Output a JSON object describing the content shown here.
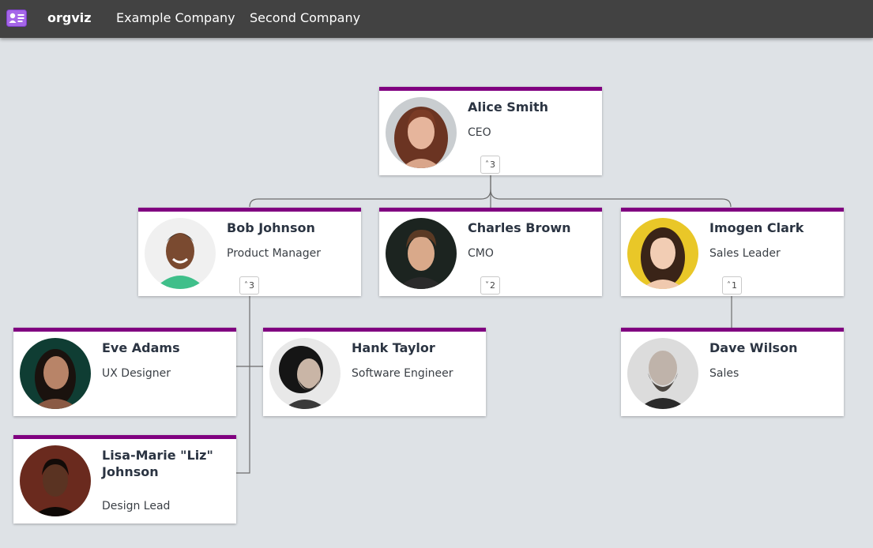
{
  "app": {
    "title": "orgviz"
  },
  "nav": {
    "items": [
      "Example Company",
      "Second Company"
    ]
  },
  "people": {
    "alice": {
      "name": "Alice Smith",
      "title": "CEO",
      "toggle": "3",
      "toggle_icon": "chevron-up-icon"
    },
    "bob": {
      "name": "Bob Johnson",
      "title": "Product Manager",
      "toggle": "3",
      "toggle_icon": "chevron-up-icon"
    },
    "charles": {
      "name": "Charles Brown",
      "title": "CMO",
      "toggle": "2",
      "toggle_icon": "chevron-down-icon"
    },
    "imogen": {
      "name": "Imogen Clark",
      "title": "Sales Leader",
      "toggle": "1",
      "toggle_icon": "chevron-up-icon"
    },
    "eve": {
      "name": "Eve Adams",
      "title": "UX Designer"
    },
    "hank": {
      "name": "Hank Taylor",
      "title": "Software Engineer"
    },
    "dave": {
      "name": "Dave Wilson",
      "title": "Sales"
    },
    "lisa": {
      "name": "Lisa-Marie \"Liz\" Johnson",
      "title": "Design Lead"
    }
  },
  "colors": {
    "accent": "#800080",
    "topbar": "#424242",
    "background": "#dee2e6",
    "connector": "#6d6d6d"
  }
}
